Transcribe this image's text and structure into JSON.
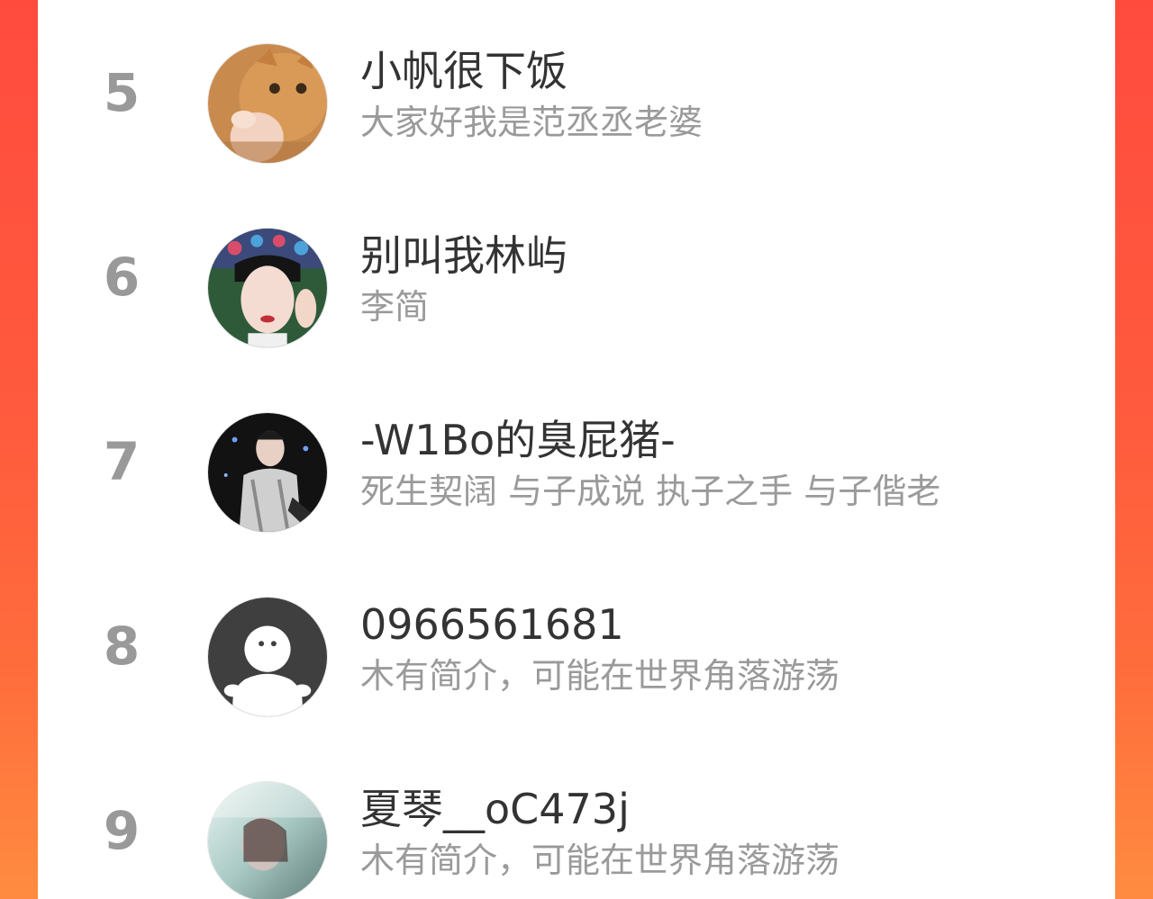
{
  "ranking": {
    "items": [
      {
        "rank": "5",
        "name": "小帆很下饭",
        "bio": "大家好我是范丞丞老婆",
        "avatar": "cat-photo-avatar"
      },
      {
        "rank": "6",
        "name": "别叫我林屿",
        "bio": "李简",
        "avatar": "costume-actress-avatar"
      },
      {
        "rank": "7",
        "name": "-W1Bo的臭屁猪-",
        "bio": "死生契阔 与子成说 执子之手 与子偕老",
        "avatar": "stage-performer-avatar"
      },
      {
        "rank": "8",
        "name": "0966561681",
        "bio": "木有简介，可能在世界角落游荡",
        "avatar": "default-user-avatar"
      },
      {
        "rank": "9",
        "name": "夏琴__oC473j",
        "bio": "木有简介，可能在世界角落游荡",
        "avatar": "portrait-photo-avatar"
      }
    ]
  },
  "colors": {
    "background_gradient_top": "#ff4b3e",
    "background_gradient_bottom": "#ff8c40",
    "panel": "#ffffff",
    "rank_text": "#999999",
    "name_text": "#333333",
    "bio_text": "#9a9a9a"
  }
}
